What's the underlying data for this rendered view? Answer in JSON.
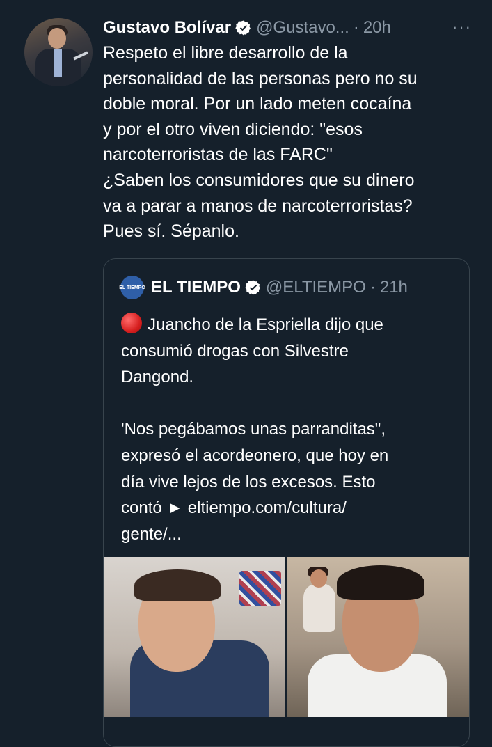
{
  "tweet": {
    "author_name": "Gustavo Bolívar",
    "handle": "@Gustavo...",
    "separator": "·",
    "time": "20h",
    "more_label": "···",
    "lines": [
      "Respeto el libre desarrollo de la",
      "personalidad de las personas pero no su",
      "doble moral. Por un lado meten cocaína",
      "y por el otro viven diciendo: \"esos",
      "narcoterroristas de las FARC\"",
      "¿Saben los consumidores que su dinero",
      "va a parar a manos de narcoterroristas?",
      "Pues sí. Sépanlo."
    ]
  },
  "quoted": {
    "logo_text": "EL TIEMPO",
    "author_name": "EL TIEMPO",
    "handle": "@ELTIEMPO",
    "separator": "·",
    "time": "21h",
    "lines": [
      "Juancho de la Espriella dijo que",
      "consumió drogas con Silvestre",
      "Dangond.",
      "",
      "'Nos pegábamos unas parranditas\",",
      "expresó el acordeonero, que hoy en",
      "día vive lejos de los excesos. Esto",
      "contó ► eltiempo.com/cultura/",
      "gente/..."
    ]
  },
  "colors": {
    "background": "#15202b",
    "text": "#ffffff",
    "muted": "#8b98a5",
    "border": "#38444d"
  }
}
